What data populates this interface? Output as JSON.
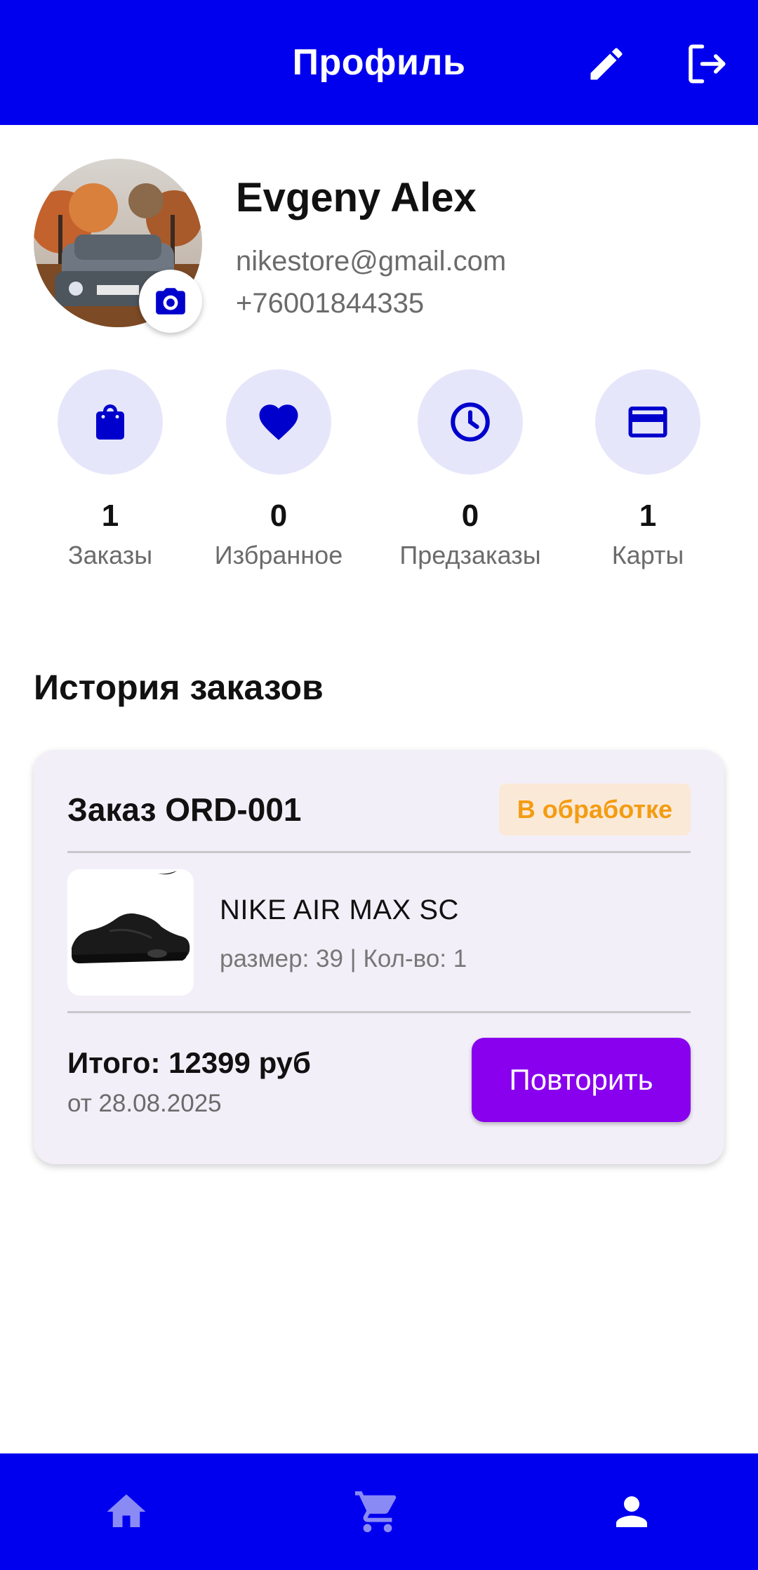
{
  "appbar": {
    "title": "Профиль",
    "edit_icon": "pencil-icon",
    "logout_icon": "logout-icon"
  },
  "profile": {
    "name": "Evgeny Alex",
    "email": "nikestore@gmail.com",
    "phone": "+76001844335",
    "avatar_icon": "user-photo",
    "camera_icon": "camera-icon"
  },
  "stats": [
    {
      "icon": "shopping-bag-icon",
      "count": "1",
      "label": "Заказы"
    },
    {
      "icon": "heart-icon",
      "count": "0",
      "label": "Избранное"
    },
    {
      "icon": "clock-icon",
      "count": "0",
      "label": "Предзаказы"
    },
    {
      "icon": "credit-card-icon",
      "count": "1",
      "label": "Карты"
    }
  ],
  "orders_section": {
    "title": "История заказов"
  },
  "order": {
    "title": "Заказ ORD-001",
    "status": "В обработке",
    "product_name": "NIKE AIR MAX SC",
    "product_meta": "размер: 39 | Кол-во: 1",
    "total": "Итого: 12399 руб",
    "date": "от 28.08.2025",
    "repeat_label": "Повторить"
  },
  "bottom_nav": [
    {
      "icon": "home-icon",
      "active": false
    },
    {
      "icon": "cart-icon",
      "active": false
    },
    {
      "icon": "person-icon",
      "active": true
    }
  ],
  "colors": {
    "primary": "#0000ee",
    "accent_button": "#8800ee",
    "status_text": "#f39c12",
    "status_bg": "#fbe9d8",
    "stat_circle": "#e6e6fb",
    "card_bg": "#f3eff8"
  }
}
